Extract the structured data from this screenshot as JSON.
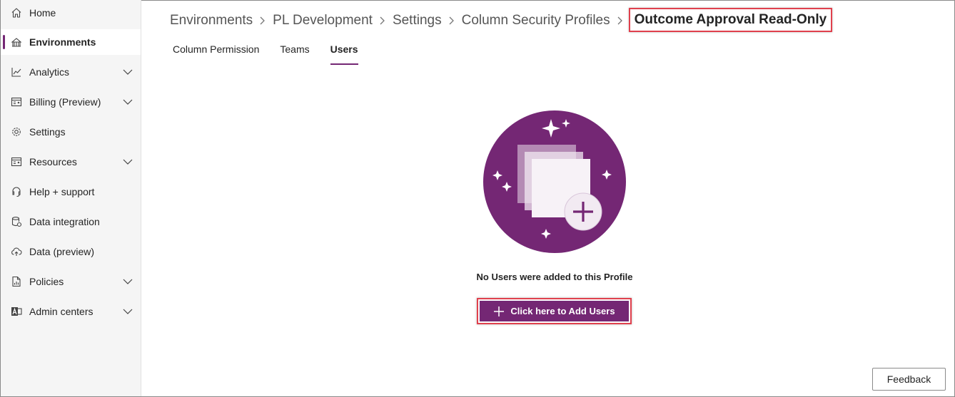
{
  "sidebar": {
    "items": [
      {
        "label": "Home",
        "icon": "home-icon",
        "expandable": false,
        "active": false
      },
      {
        "label": "Environments",
        "icon": "globe-icon",
        "expandable": false,
        "active": true
      },
      {
        "label": "Analytics",
        "icon": "chart-icon",
        "expandable": true,
        "active": false
      },
      {
        "label": "Billing (Preview)",
        "icon": "billing-icon",
        "expandable": true,
        "active": false
      },
      {
        "label": "Settings",
        "icon": "gear-icon",
        "expandable": false,
        "active": false
      },
      {
        "label": "Resources",
        "icon": "resources-icon",
        "expandable": true,
        "active": false
      },
      {
        "label": "Help + support",
        "icon": "headset-icon",
        "expandable": false,
        "active": false
      },
      {
        "label": "Data integration",
        "icon": "database-icon",
        "expandable": false,
        "active": false
      },
      {
        "label": "Data (preview)",
        "icon": "cloud-icon",
        "expandable": false,
        "active": false
      },
      {
        "label": "Policies",
        "icon": "policy-icon",
        "expandable": true,
        "active": false
      },
      {
        "label": "Admin centers",
        "icon": "admin-icon",
        "expandable": true,
        "active": false
      }
    ]
  },
  "breadcrumb": {
    "items": [
      "Environments",
      "PL Development",
      "Settings",
      "Column Security Profiles"
    ],
    "current": "Outcome Approval Read-Only"
  },
  "tabs": [
    {
      "label": "Column Permission",
      "active": false
    },
    {
      "label": "Teams",
      "active": false
    },
    {
      "label": "Users",
      "active": true
    }
  ],
  "empty_state": {
    "message": "No Users were added to this Profile",
    "add_button": "Click here to Add Users"
  },
  "feedback_label": "Feedback",
  "colors": {
    "accent": "#742774",
    "highlight": "#e0404d"
  }
}
